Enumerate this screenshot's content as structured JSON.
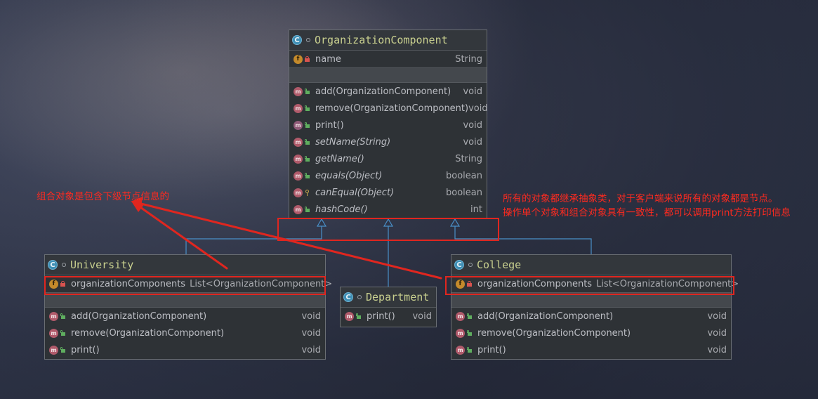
{
  "diagram": {
    "classes": {
      "organization_component": {
        "name": "OrganizationComponent",
        "fields": [
          {
            "name": "name",
            "type": "String"
          }
        ],
        "methods": [
          {
            "name": "add(OrganizationComponent)",
            "type": "void",
            "italic": false
          },
          {
            "name": "remove(OrganizationComponent)",
            "type": "void",
            "italic": false
          },
          {
            "name": "print()",
            "type": "void",
            "italic": false
          },
          {
            "name": "setName(String)",
            "type": "void",
            "italic": true
          },
          {
            "name": "getName()",
            "type": "String",
            "italic": true
          },
          {
            "name": "equals(Object)",
            "type": "boolean",
            "italic": true
          },
          {
            "name": "canEqual(Object)",
            "type": "boolean",
            "italic": true
          },
          {
            "name": "hashCode()",
            "type": "int",
            "italic": true
          }
        ]
      },
      "university": {
        "name": "University",
        "field": {
          "name": "organizationComponents",
          "type": "List<OrganizationComponent>"
        },
        "methods": [
          {
            "name": "add(OrganizationComponent)",
            "type": "void"
          },
          {
            "name": "remove(OrganizationComponent)",
            "type": "void"
          },
          {
            "name": "print()",
            "type": "void"
          }
        ]
      },
      "department": {
        "name": "Department",
        "methods": [
          {
            "name": "print()",
            "type": "void"
          }
        ]
      },
      "college": {
        "name": "College",
        "field": {
          "name": "organizationComponents",
          "type": "List<OrganizationComponent>"
        },
        "methods": [
          {
            "name": "add(OrganizationComponent)",
            "type": "void"
          },
          {
            "name": "remove(OrganizationComponent)",
            "type": "void"
          },
          {
            "name": "print()",
            "type": "void"
          }
        ]
      }
    },
    "relationships": [
      {
        "from": "University",
        "to": "OrganizationComponent",
        "kind": "inheritance"
      },
      {
        "from": "Department",
        "to": "OrganizationComponent",
        "kind": "inheritance"
      },
      {
        "from": "College",
        "to": "OrganizationComponent",
        "kind": "inheritance"
      }
    ],
    "annotations": {
      "left_note": "组合对象是包含下级节点信息的",
      "right_note_line1": "所有的对象都继承抽象类，对于客户端来说所有的对象都是节点。",
      "right_note_line2": "操作单个对象和组合对象具有一致性，都可以调用print方法打印信息"
    },
    "colors": {
      "annotation_red": "#e0261f",
      "class_title": "#c9d08f",
      "line_blue": "#4a90c8"
    }
  }
}
